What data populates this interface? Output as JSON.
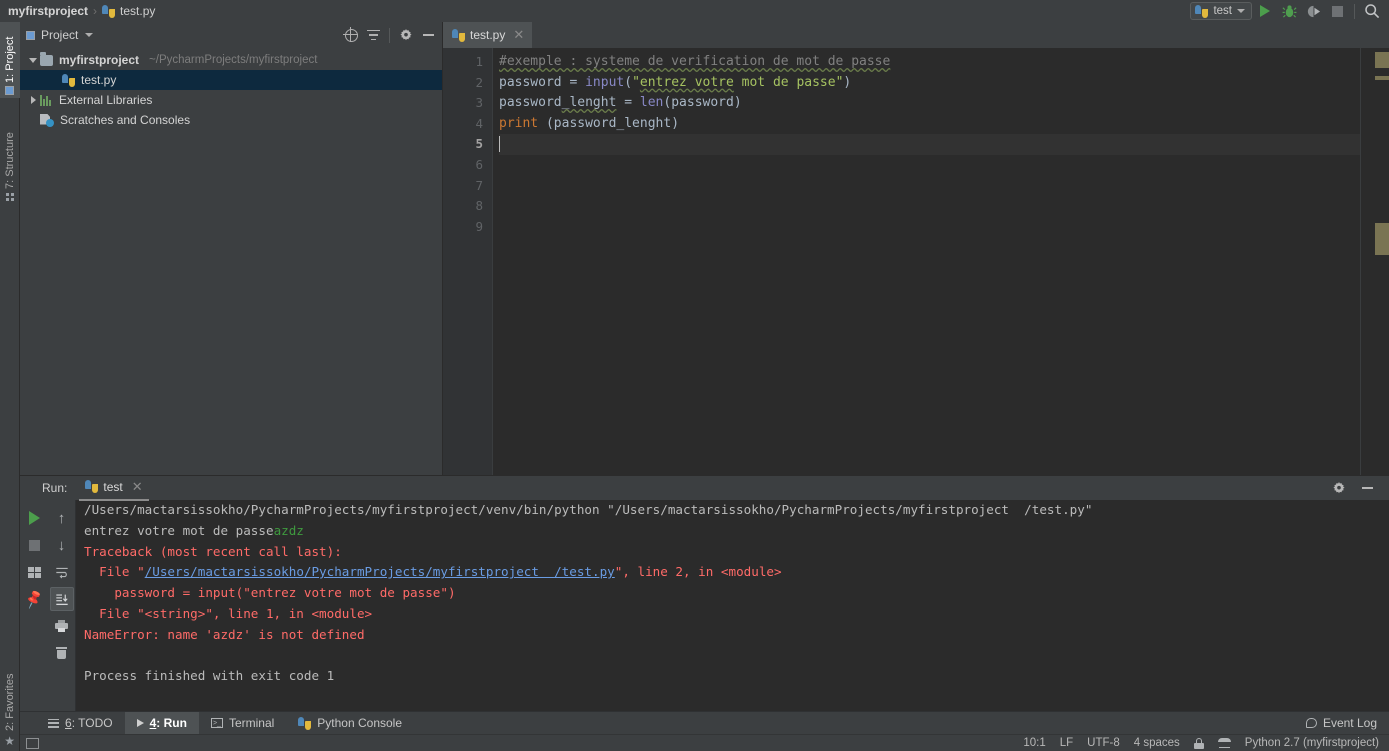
{
  "topbar": {
    "breadcrumb": {
      "project": "myfirstproject",
      "separator": "›",
      "file": "test.py",
      "file_icon": "python-file-icon"
    },
    "run_config": {
      "label": "test",
      "icon": "python-icon",
      "dropdown_icon": "chevron-down-icon"
    },
    "actions": [
      {
        "name": "run-button",
        "icon": "play-icon",
        "label": "Run"
      },
      {
        "name": "debug-button",
        "icon": "bug-icon",
        "label": "Debug"
      },
      {
        "name": "run-coverage-button",
        "icon": "coverage-icon",
        "label": "Run with Coverage"
      },
      {
        "name": "stop-button",
        "icon": "stop-icon",
        "label": "Stop"
      },
      {
        "name": "search-everywhere-button",
        "icon": "search-icon",
        "label": "Search Everywhere"
      }
    ]
  },
  "left_strip": {
    "tabs": [
      {
        "label": "1: Project",
        "icon": "project-icon",
        "active": true
      },
      {
        "label": "7: Structure",
        "icon": "structure-icon",
        "active": false
      },
      {
        "label": "2: Favorites",
        "icon": "star-icon",
        "active": false
      }
    ]
  },
  "project_panel": {
    "title": "Project",
    "dropdown_icon": "chevron-down-icon",
    "actions": [
      {
        "name": "select-opened-file-button",
        "icon": "crosshair-icon"
      },
      {
        "name": "collapse-all-button",
        "icon": "collapse-all-icon"
      },
      {
        "name": "settings-button",
        "icon": "gear-icon"
      },
      {
        "name": "hide-panel-button",
        "icon": "minus-icon"
      }
    ],
    "tree": [
      {
        "label": "myfirstproject",
        "path": "~/PycharmProjects/myfirstproject",
        "icon": "folder-icon",
        "arrow": "down",
        "indent": 0,
        "bold": true,
        "selected": false
      },
      {
        "label": "test.py",
        "path": "",
        "icon": "python-file-icon",
        "arrow": "none",
        "indent": 1,
        "bold": false,
        "selected": true
      },
      {
        "label": "External Libraries",
        "path": "",
        "icon": "library-icon",
        "arrow": "right",
        "indent": 0,
        "bold": false,
        "selected": false
      },
      {
        "label": "Scratches and Consoles",
        "path": "",
        "icon": "scratches-icon",
        "arrow": "none",
        "indent": 0,
        "bold": false,
        "selected": false
      }
    ]
  },
  "editor": {
    "tab": {
      "label": "test.py",
      "icon": "python-file-icon",
      "close_icon": "close-icon"
    },
    "line_numbers": [
      "1",
      "2",
      "3",
      "4",
      "5",
      "6",
      "7",
      "8",
      "9"
    ],
    "current_line": 5,
    "code_lines": [
      {
        "n": 1,
        "tokens": [
          {
            "t": "#exemple : systeme de verification de mot de passe",
            "c": "tok-com sp"
          }
        ]
      },
      {
        "n": 2,
        "tokens": [
          {
            "t": "password ",
            "c": "tok-def"
          },
          {
            "t": "= ",
            "c": "tok-def"
          },
          {
            "t": "input",
            "c": "tok-fn"
          },
          {
            "t": "(",
            "c": "tok-def"
          },
          {
            "t": "\"",
            "c": "tok-str"
          },
          {
            "t": "entrez votre",
            "c": "tok-str sp"
          },
          {
            "t": " mot de passe\"",
            "c": "tok-str"
          },
          {
            "t": ")",
            "c": "tok-def"
          }
        ]
      },
      {
        "n": 3,
        "tokens": [
          {
            "t": "password",
            "c": "tok-def"
          },
          {
            "t": "_lenght",
            "c": "tok-def sp"
          },
          {
            "t": " = ",
            "c": "tok-def"
          },
          {
            "t": "len",
            "c": "tok-fn"
          },
          {
            "t": "(password)",
            "c": "tok-def"
          }
        ]
      },
      {
        "n": 4,
        "tokens": [
          {
            "t": "print",
            "c": "tok-kw"
          },
          {
            "t": " (password_lenght)",
            "c": "tok-def"
          }
        ]
      },
      {
        "n": 5,
        "tokens": []
      },
      {
        "n": 6,
        "tokens": []
      },
      {
        "n": 7,
        "tokens": []
      },
      {
        "n": 8,
        "tokens": []
      },
      {
        "n": 9,
        "tokens": []
      }
    ],
    "marker_color": "#7a7453"
  },
  "run_panel": {
    "label": "Run:",
    "tab": {
      "label": "test",
      "icon": "python-icon",
      "close_icon": "close-icon"
    },
    "header_actions": [
      {
        "name": "run-settings-button",
        "icon": "gear-icon"
      },
      {
        "name": "hide-run-panel-button",
        "icon": "minus-icon"
      }
    ],
    "toolbar_left": [
      {
        "name": "rerun-button",
        "icon": "run-icon"
      },
      {
        "name": "stop-process-button",
        "icon": "stop-icon"
      },
      {
        "name": "show-console-button",
        "icon": "console-icon"
      },
      {
        "name": "pin-tab-button",
        "icon": "pin-icon"
      }
    ],
    "toolbar_right": [
      {
        "name": "up-the-stack-trace-button",
        "icon": "arrow-up-icon"
      },
      {
        "name": "down-the-stack-trace-button",
        "icon": "arrow-down-icon"
      },
      {
        "name": "soft-wrap-button",
        "icon": "soft-wrap-icon"
      },
      {
        "name": "scroll-to-end-button",
        "icon": "scroll-to-end-icon",
        "active": true
      },
      {
        "name": "print-button",
        "icon": "print-icon"
      },
      {
        "name": "clear-all-button",
        "icon": "trash-icon"
      }
    ],
    "console_lines": [
      {
        "segs": [
          {
            "t": "/Users/mactarsissokho/PycharmProjects/myfirstproject/venv/bin/python \"/Users/mactarsissokho/PycharmProjects/myfirstproject  /test.py\"",
            "c": "c-norm"
          }
        ]
      },
      {
        "segs": [
          {
            "t": "entrez votre mot de passe",
            "c": "c-norm"
          },
          {
            "t": "azdz",
            "c": "c-green"
          }
        ]
      },
      {
        "segs": [
          {
            "t": "Traceback (most recent call last):",
            "c": "c-err"
          }
        ]
      },
      {
        "segs": [
          {
            "t": "  File \"",
            "c": "c-err"
          },
          {
            "t": "/Users/mactarsissokho/PycharmProjects/myfirstproject  /test.py",
            "c": "c-link"
          },
          {
            "t": "\", line 2, in <module>",
            "c": "c-err"
          }
        ]
      },
      {
        "segs": [
          {
            "t": "    password = input(\"entrez votre mot de passe\")",
            "c": "c-err"
          }
        ]
      },
      {
        "segs": [
          {
            "t": "  File \"<string>\", line 1, in <module>",
            "c": "c-err"
          }
        ]
      },
      {
        "segs": [
          {
            "t": "NameError: name 'azdz' is not defined",
            "c": "c-err"
          }
        ]
      },
      {
        "segs": [
          {
            "t": "",
            "c": "c-norm"
          }
        ]
      },
      {
        "segs": [
          {
            "t": "Process finished with exit code 1",
            "c": "c-norm"
          }
        ]
      }
    ]
  },
  "bottom_tabs": [
    {
      "label_num": "6",
      "label": ": TODO",
      "icon": "todo-list-icon",
      "active": false
    },
    {
      "label_num": "4",
      "label": ": Run",
      "icon": "play-icon",
      "active": true
    },
    {
      "label_num": "",
      "label": "Terminal",
      "icon": "terminal-icon",
      "active": false
    },
    {
      "label_num": "",
      "label": "Python Console",
      "icon": "python-icon",
      "active": false
    }
  ],
  "event_log": {
    "label": "Event Log",
    "icon": "balloon-icon"
  },
  "statusbar": {
    "items": [
      {
        "name": "caret-position",
        "label": "10:1"
      },
      {
        "name": "line-separator",
        "label": "LF"
      },
      {
        "name": "file-encoding",
        "label": "UTF-8"
      },
      {
        "name": "indent-setting",
        "label": "4 spaces"
      },
      {
        "name": "lock-icon",
        "label": ""
      },
      {
        "name": "database-icon",
        "label": ""
      },
      {
        "name": "python-interpreter",
        "label": "Python 2.7 (myfirstproject)"
      }
    ]
  }
}
